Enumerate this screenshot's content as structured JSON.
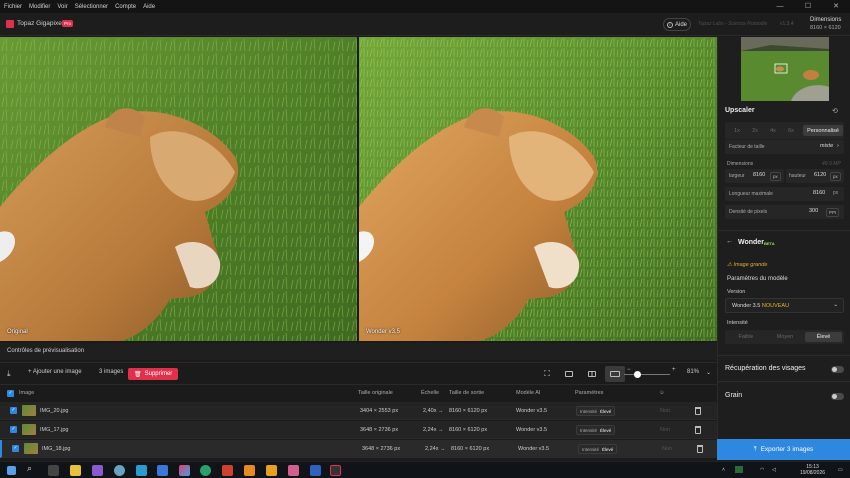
{
  "menu": [
    "Fichier",
    "Modifier",
    "Voir",
    "Sélectionner",
    "Compte",
    "Aide"
  ],
  "header": {
    "app_name": "Topaz Gigapixel",
    "badge": "Pro",
    "help": "Aide",
    "faint_text": "Topaz Labs - Science Rotandie",
    "version": "v1.3.4",
    "dims_title": "Dimensions",
    "dims_value": "8160 × 6120"
  },
  "preview": {
    "left_label": "Original",
    "right_label": "Wonder v3.5",
    "controls_label": "Contrôles de prévisualisation"
  },
  "toolbar": {
    "add_image": "Ajouter une image",
    "count": "3 images",
    "delete": "Supprimer",
    "zoom": "81%"
  },
  "table": {
    "headers": {
      "image": "Image",
      "orig": "Taille originale",
      "scale": "Échelle",
      "out": "Taille de sortie",
      "model": "Modèle AI",
      "params": "Paramètres"
    },
    "rows": [
      {
        "name": "IMG_20.jpg",
        "orig": "3404 × 2553 px",
        "scale": "2,40x →",
        "out": "8160 × 6120 px",
        "model": "Wonder v3.5",
        "param_key": "Intensité",
        "param_val": "Élevé",
        "extra": "Non"
      },
      {
        "name": "IMG_17.jpg",
        "orig": "3648 × 2736 px",
        "scale": "2,24x →",
        "out": "8160 × 6120 px",
        "model": "Wonder v3.5",
        "param_key": "Intensité",
        "param_val": "Élevé",
        "extra": "Non"
      },
      {
        "name": "IMG_18.jpg",
        "orig": "3648 × 2736 px",
        "scale": "2,24x →",
        "out": "8160 × 6120 px",
        "model": "Wonder v3.5",
        "param_key": "Intensité",
        "param_val": "Élevé",
        "extra": "Non"
      }
    ]
  },
  "upscaler": {
    "title": "Upscaler",
    "scales": [
      "1x",
      "2x",
      "4x",
      "6x",
      "Personnalisé"
    ],
    "factor_label": "Facteur de taille",
    "factor_value": "mixte",
    "dims_label": "Dimensions",
    "dims_mp": "49.9 MP",
    "width_label": "largeur",
    "width_value": "8160",
    "height_label": "hauteur",
    "height_value": "6120",
    "unit": "px",
    "maxlen_label": "Longueur maximale",
    "maxlen_value": "8160",
    "density_label": "Densité de pixels",
    "density_value": "300",
    "density_unit": "PPI"
  },
  "model": {
    "name": "Wonder",
    "beta": "BETA",
    "warning": "Image grande",
    "params_title": "Paramètres du modèle",
    "version_label": "Version",
    "version_value": "Wonder 3.5",
    "version_new": "NOUVEAU",
    "intensity_label": "Intensité",
    "intensity_options": [
      "Faible",
      "Moyen",
      "Élevé"
    ]
  },
  "extras": {
    "face_recovery": "Récupération des visages",
    "grain": "Grain"
  },
  "export_label": "Exporter 3 images",
  "clock": {
    "time": "15:13",
    "date": "19/08/2026"
  }
}
